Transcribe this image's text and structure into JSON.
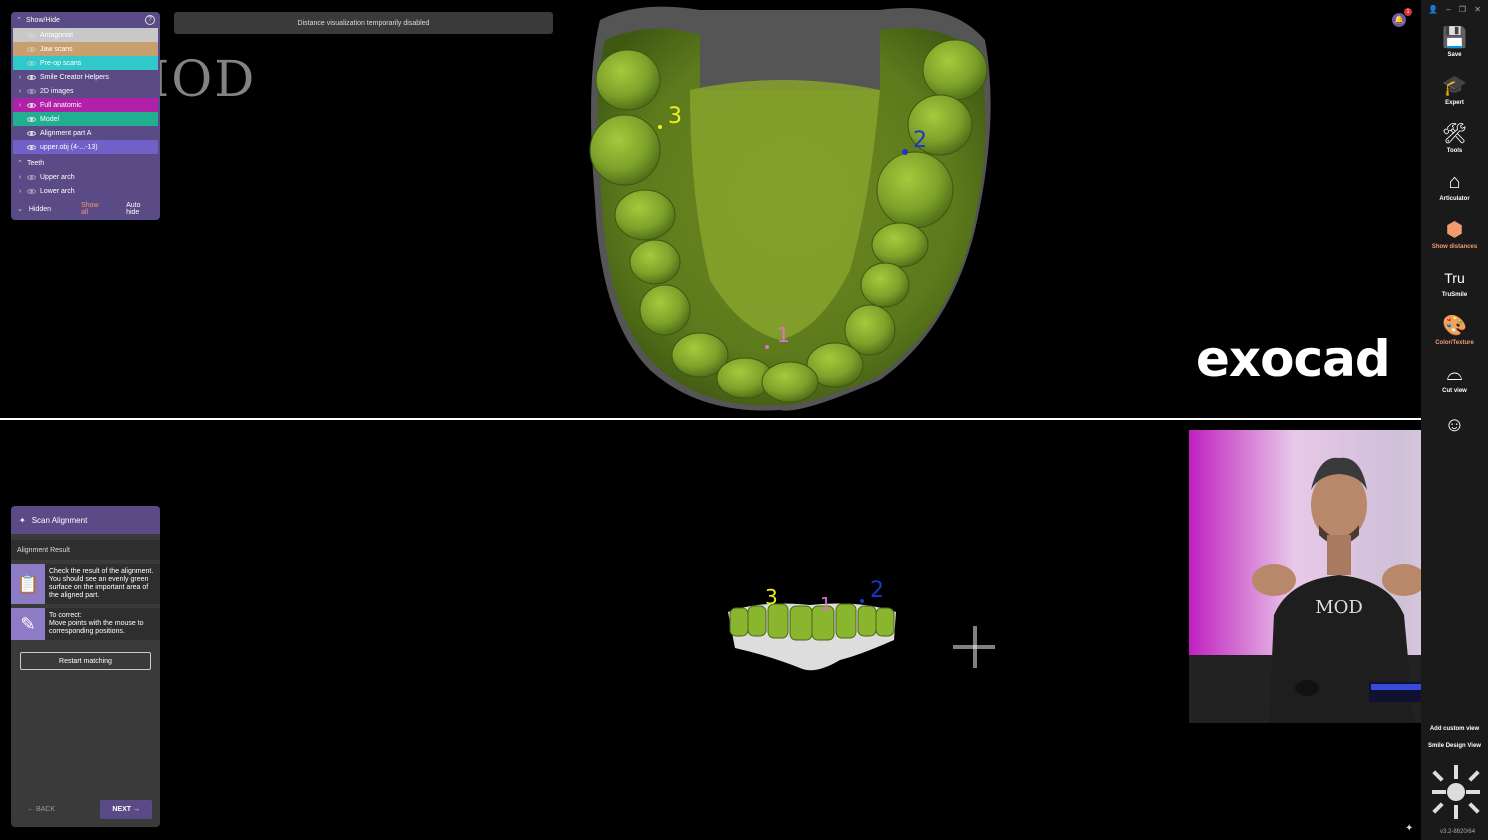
{
  "banner": {
    "text": "Distance visualization temporarily disabled"
  },
  "watermark": {
    "text": "MOD"
  },
  "notification": {
    "count": "1"
  },
  "logo": {
    "text": "exocad"
  },
  "show_hide": {
    "title": "Show/Hide",
    "items": [
      {
        "label": "Antagonist",
        "color": "#c8c8c8",
        "expandable": false
      },
      {
        "label": "Jaw scans",
        "color": "#c8a070",
        "expandable": false
      },
      {
        "label": "Pre-op scans",
        "color": "#30c8c8",
        "expandable": false
      },
      {
        "label": "Smile Creator Helpers",
        "color": "",
        "expandable": true
      },
      {
        "label": "2D images",
        "color": "",
        "expandable": true
      },
      {
        "label": "Full anatomic",
        "color": "#b020a8",
        "expandable": true
      },
      {
        "label": "Model",
        "color": "#20b090",
        "expandable": false
      },
      {
        "label": "Alignment part A",
        "color": "",
        "expandable": false
      },
      {
        "label": "upper.obj (4-...-13)",
        "color": "#7060c8",
        "expandable": false
      }
    ],
    "teeth_section": "Teeth",
    "teeth_items": [
      {
        "label": "Upper arch"
      },
      {
        "label": "Lower arch"
      }
    ],
    "hidden_label": "Hidden",
    "show_all": "Show all",
    "auto_hide": "Auto hide"
  },
  "markers": {
    "top": [
      {
        "label": "3",
        "color": "#f0f020"
      },
      {
        "label": "2",
        "color": "#1838c8"
      },
      {
        "label": "1",
        "color": "#e070d0"
      }
    ],
    "bottom": [
      {
        "label": "3",
        "color": "#f0f020"
      },
      {
        "label": "1",
        "color": "#e070d0"
      },
      {
        "label": "2",
        "color": "#1838c8"
      }
    ]
  },
  "toolbar": {
    "tools": [
      {
        "label": "Save",
        "icon": "save-icon",
        "glyph": "💾",
        "accent": false
      },
      {
        "label": "Expert",
        "icon": "graduation-cap-icon",
        "glyph": "🎓",
        "accent": false
      },
      {
        "label": "Tools",
        "icon": "tools-icon",
        "glyph": "🛠",
        "accent": false
      },
      {
        "label": "Articulator",
        "icon": "articulator-icon",
        "glyph": "⌂",
        "accent": false
      },
      {
        "label": "Show distances",
        "icon": "tooth-distance-icon",
        "glyph": "⬢",
        "accent": true
      },
      {
        "label": "TruSmile",
        "icon": "trusmile-icon",
        "glyph": "Tru",
        "accent": false
      },
      {
        "label": "Color/Texture",
        "icon": "palette-icon",
        "glyph": "🎨",
        "accent": true
      },
      {
        "label": "Cut view",
        "icon": "cut-view-icon",
        "glyph": "⌓",
        "accent": false
      },
      {
        "label": "",
        "icon": "face-icon",
        "glyph": "☺",
        "accent": false
      }
    ],
    "add_custom_view": "Add custom view",
    "smile_design_view": "Smile Design View",
    "version": "v3.2-8820/64"
  },
  "scan_alignment": {
    "title": "Scan Alignment",
    "subtitle": "Alignment Result",
    "card1": "Check the result of the alignment. You should see an evenly green surface on the important area of the aligned part.",
    "card2_title": "To correct:",
    "card2": "Move points with the mouse to corresponding positions.",
    "restart": "Restart matching",
    "back": "BACK",
    "next": "NEXT"
  },
  "webcam": {
    "shirt_text": "MOD"
  }
}
